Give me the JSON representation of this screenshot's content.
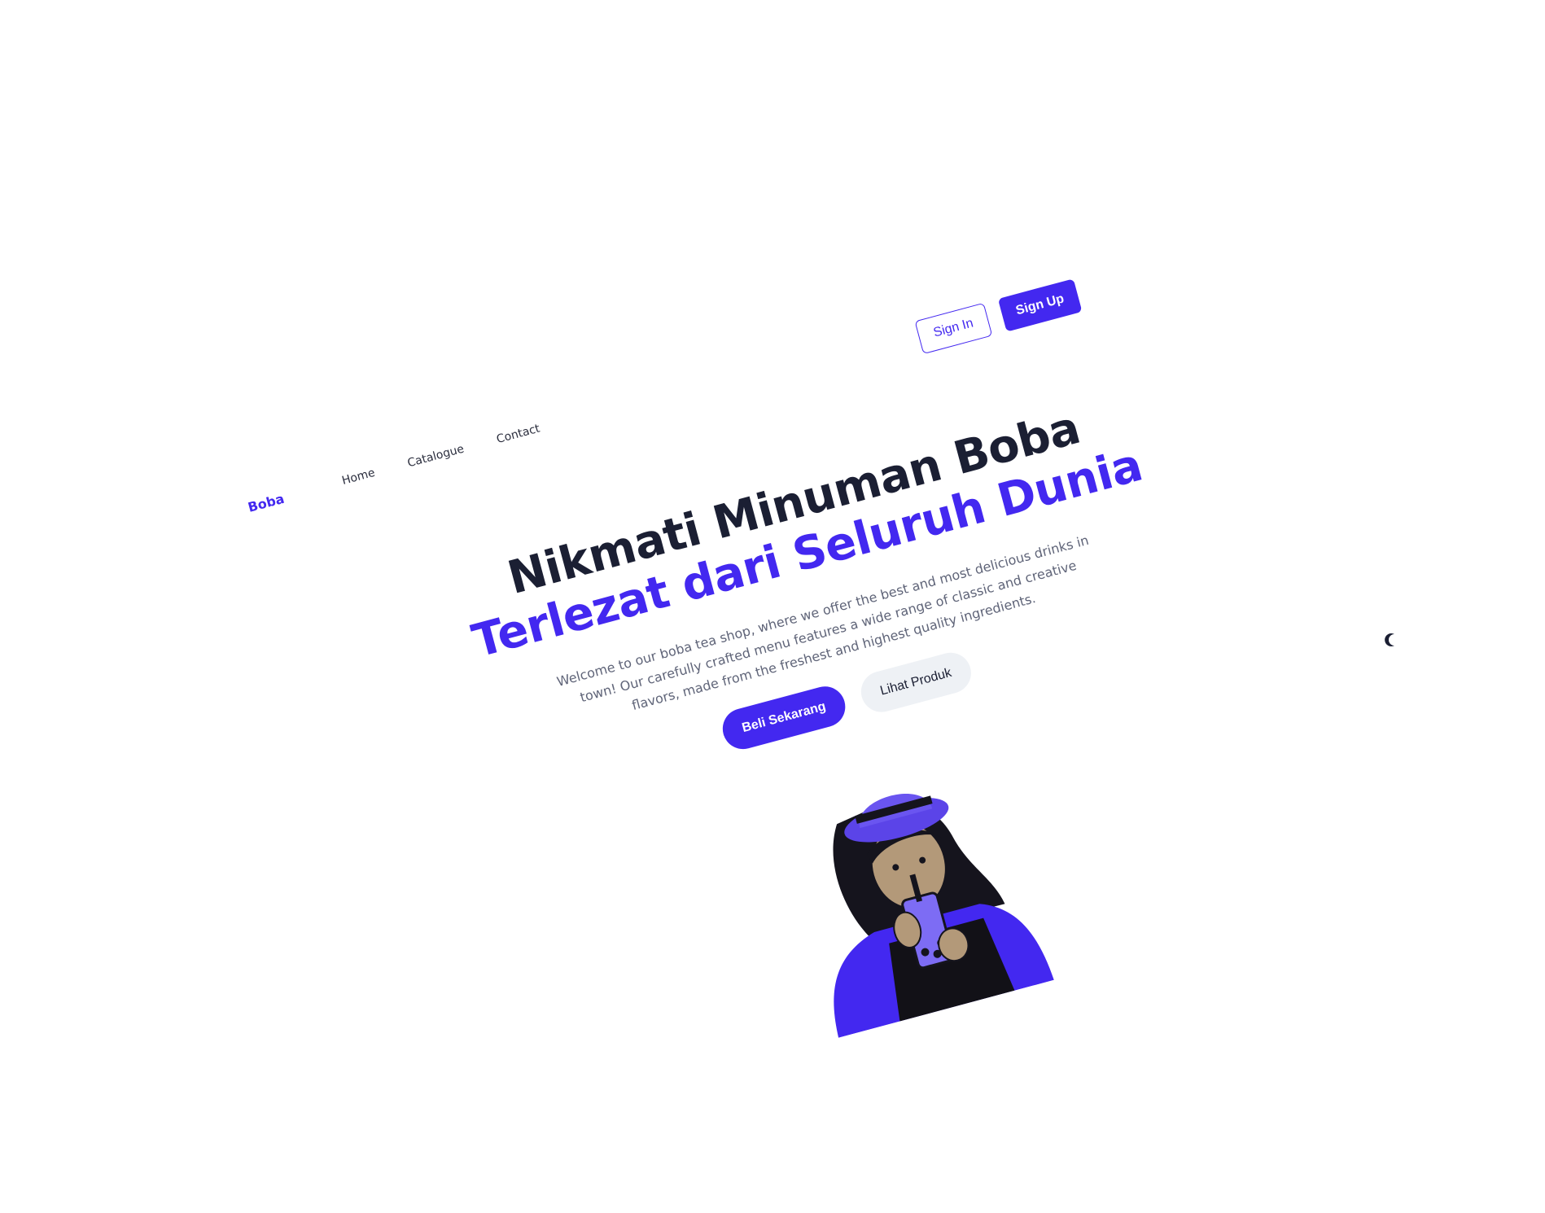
{
  "nav": {
    "brand": "Boba",
    "links": [
      "Home",
      "Catalogue",
      "Contact"
    ],
    "sign_in": "Sign In",
    "sign_up": "Sign Up"
  },
  "hero": {
    "title_line1": "Nikmati Minuman Boba",
    "title_line2": "Terlezat dari Seluruh Dunia",
    "description": "Welcome to our boba tea shop, where we offer the best and most delicious drinks in town! Our carefully crafted menu features a wide range of classic and creative flavors, made from the freshest and highest quality ingredients.",
    "primary_cta": "Beli Sekarang",
    "secondary_cta": "Lihat Produk"
  },
  "icons": {
    "theme_toggle": "moon-icon",
    "illustration": "girl-drinking-boba-illustration"
  },
  "colors": {
    "accent": "#4328f0",
    "heading": "#1b1f33",
    "muted": "#5f6478",
    "secondary_bg": "#eef1f5"
  }
}
